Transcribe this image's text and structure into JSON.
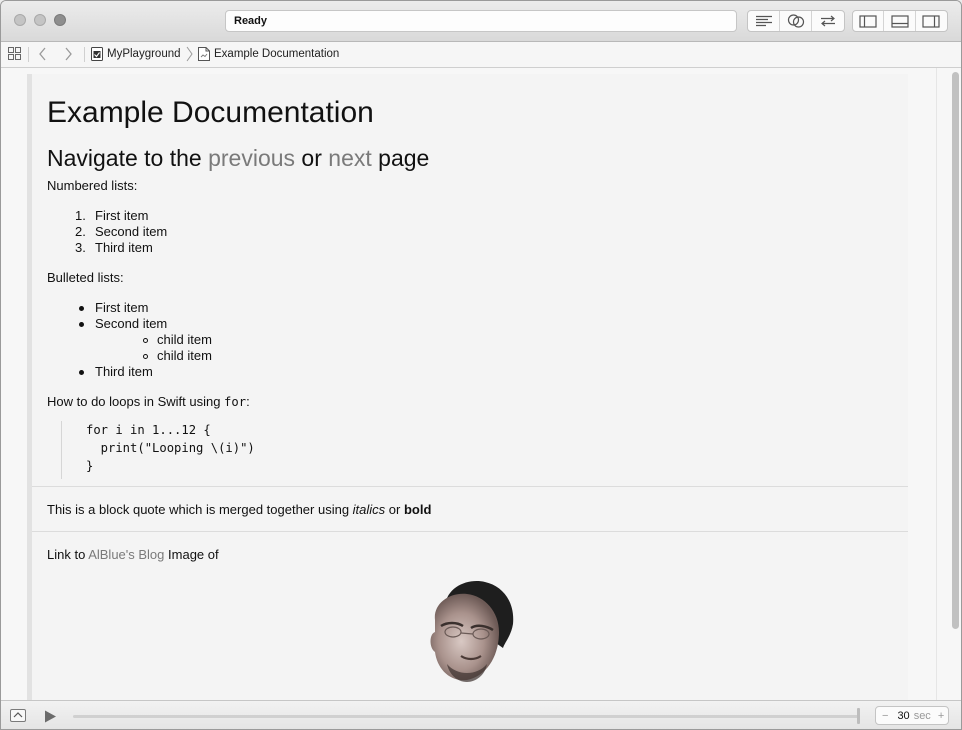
{
  "window": {
    "status": "Ready"
  },
  "breadcrumb": {
    "project": "MyPlayground",
    "page": "Example Documentation"
  },
  "doc": {
    "title": "Example Documentation",
    "nav": {
      "prefix": "Navigate to the ",
      "previous": "previous",
      "middle": " or ",
      "next": "next",
      "suffix": " page"
    },
    "numbered_heading": "Numbered lists:",
    "numbered": [
      {
        "num": "1.",
        "text": "First item"
      },
      {
        "num": "2.",
        "text": "Second item"
      },
      {
        "num": "3.",
        "text": "Third item"
      }
    ],
    "bulleted_heading": "Bulleted lists:",
    "bulleted": [
      "First item",
      "Second item",
      "Third item"
    ],
    "children": [
      "child item",
      "child item"
    ],
    "loops_text": "How to do loops in Swift using ",
    "loops_keyword": "for",
    "loops_colon": ":",
    "code": [
      "for i in 1...12 {",
      "  print(\"Looping \\(i)\")",
      "}"
    ],
    "quote": {
      "text": "This is a block quote which is merged together using ",
      "italic": "italics",
      "or": " or ",
      "bold": "bold"
    },
    "link_line": {
      "prefix": "Link to ",
      "link": "AlBlue's Blog",
      "suffix": " Image of"
    }
  },
  "bottom": {
    "timer_value": "30",
    "timer_unit": "sec",
    "minus": "−",
    "plus": "+"
  },
  "icons": [
    "grid-icon",
    "back-chevron-icon",
    "forward-chevron-icon",
    "playground-icon",
    "page-icon",
    "editor-standard-icon",
    "editor-assistant-icon",
    "editor-version-icon",
    "navigator-panel-icon",
    "debug-panel-icon",
    "utilities-panel-icon",
    "play-icon",
    "debug-toggle-icon"
  ]
}
